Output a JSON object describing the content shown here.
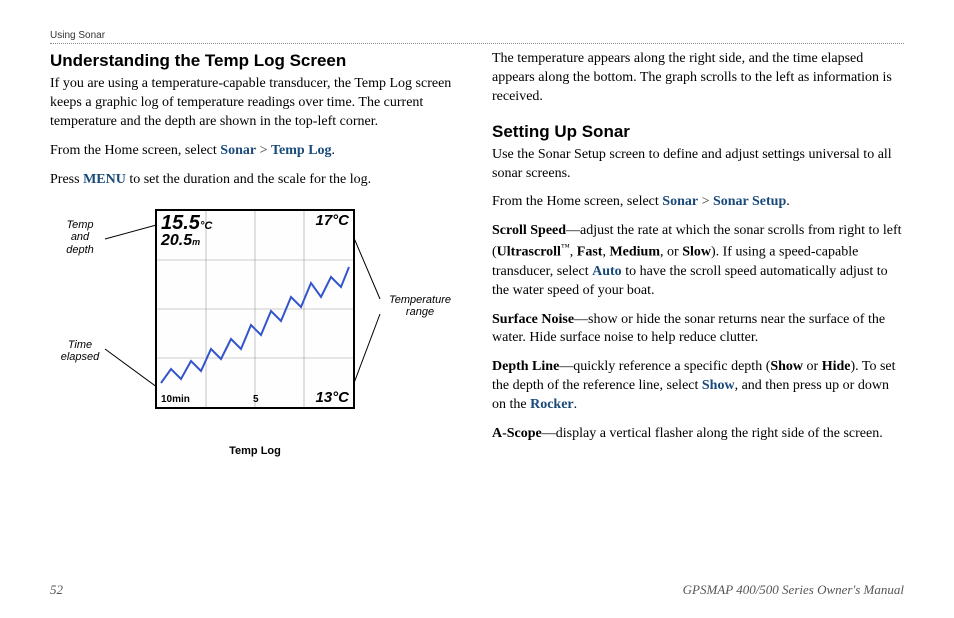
{
  "header": {
    "section": "Using Sonar"
  },
  "footer": {
    "page": "52",
    "manual": "GPSMAP 400/500 Series Owner's Manual"
  },
  "left": {
    "h": "Understanding the Temp Log Screen",
    "p1": "If you are using a temperature-capable transducer, the Temp Log screen keeps a graphic log of temperature readings over time. The current temperature and the depth are shown in the top-left corner.",
    "p2a": "From the Home screen, select ",
    "nav_sonar": "Sonar",
    "nav_gt": " > ",
    "nav_templog": "Temp Log",
    "p2b": ".",
    "p3a": "Press ",
    "menu": "MENU",
    "p3b": " to set the duration and the scale for the log.",
    "annot_tl": "Temp\nand\ndepth",
    "annot_bl": "Time\nelapsed",
    "annot_r": "Temperature\nrange",
    "caption": "Temp Log",
    "scr": {
      "temp": "15.5",
      "temp_unit": "°C",
      "depth": "20.5",
      "depth_unit": "m",
      "top_right": "17°C",
      "bot_right": "13°C",
      "x_left": "10min",
      "x_mid": "5"
    }
  },
  "right": {
    "p0": "The temperature appears along the right side, and the time elapsed appears along the bottom. The graph scrolls to the left as information is received.",
    "h": "Setting Up Sonar",
    "p1": "Use the Sonar Setup screen to define and adjust settings universal to all sonar screens.",
    "p2a": "From the Home screen, select ",
    "nav_sonar": "Sonar",
    "nav_gt": " > ",
    "nav_setup": "Sonar Setup",
    "p2b": ".",
    "ss_label": "Scroll Speed",
    "ss_a": "—adjust the rate at which the sonar scrolls from right to left (",
    "ss_us": "Ultrascroll",
    "ss_tm": "™",
    "ss_sep1": ", ",
    "ss_fast": "Fast",
    "ss_sep2": ", ",
    "ss_med": "Medium",
    "ss_sep3": ", or ",
    "ss_slow": "Slow",
    "ss_b": "). If using a speed-capable transducer, select ",
    "ss_auto": "Auto",
    "ss_c": " to have the scroll speed automatically adjust to the water speed of your boat.",
    "sn_label": "Surface Noise",
    "sn_a": "—show or hide the sonar returns near the surface of the water. Hide surface noise to help reduce clutter.",
    "dl_label": "Depth Line",
    "dl_a": "—quickly reference a specific depth (",
    "dl_show": "Show",
    "dl_or": " or ",
    "dl_hide": "Hide",
    "dl_b": "). To set the depth of the reference line, select ",
    "dl_show2": "Show",
    "dl_c": ", and then press up or down on the ",
    "dl_rocker": "Rocker",
    "dl_d": ".",
    "as_label": "A-Scope",
    "as_a": "—display a vertical flasher along the right side of the screen."
  },
  "chart_data": {
    "type": "line",
    "title": "Temp Log",
    "xlabel": "Time elapsed (min ago)",
    "ylabel": "Temperature (°C)",
    "ylim": [
      13,
      17
    ],
    "xlim": [
      10,
      0
    ],
    "current_temp_c": 15.5,
    "current_depth_m": 20.5,
    "x": [
      10.0,
      9.5,
      9.0,
      8.5,
      8.0,
      7.5,
      7.0,
      6.5,
      6.0,
      5.5,
      5.0,
      4.5,
      4.0,
      3.5,
      3.0,
      2.5,
      2.0,
      1.5,
      1.0,
      0.5,
      0.0
    ],
    "values": [
      13.3,
      13.6,
      13.4,
      13.8,
      13.6,
      14.1,
      13.9,
      14.3,
      14.1,
      14.6,
      14.4,
      14.9,
      14.7,
      15.2,
      15.0,
      15.5,
      15.2,
      15.6,
      15.4,
      15.8,
      15.5
    ]
  }
}
